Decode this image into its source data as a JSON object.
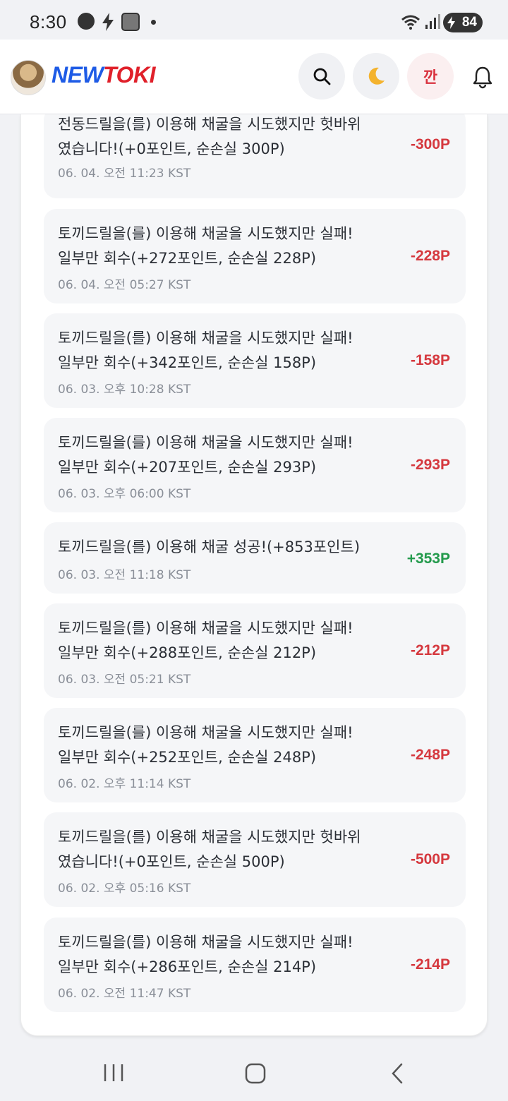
{
  "status": {
    "time": "8:30",
    "battery": "84"
  },
  "header": {
    "logo_part1": "NEW",
    "logo_part2": "TOKI",
    "kkan_label": "깐"
  },
  "points_history": [
    {
      "line1": "전동드릴을(를) 이용해 채굴을 시도했지만 헛바위",
      "line2": "였습니다!(+0포인트, 순손실 300P)",
      "time": "06. 04. 오전 11:23 KST",
      "amount": "-300P",
      "positive": false
    },
    {
      "line1": "토끼드릴을(를) 이용해 채굴을 시도했지만 실패!",
      "line2": "일부만 회수(+272포인트, 순손실 228P)",
      "time": "06. 04. 오전 05:27 KST",
      "amount": "-228P",
      "positive": false
    },
    {
      "line1": "토끼드릴을(를) 이용해 채굴을 시도했지만 실패!",
      "line2": "일부만 회수(+342포인트, 순손실 158P)",
      "time": "06. 03. 오후 10:28 KST",
      "amount": "-158P",
      "positive": false
    },
    {
      "line1": "토끼드릴을(를) 이용해 채굴을 시도했지만 실패!",
      "line2": "일부만 회수(+207포인트, 순손실 293P)",
      "time": "06. 03. 오후 06:00 KST",
      "amount": "-293P",
      "positive": false
    },
    {
      "line1": "토끼드릴을(를) 이용해 채굴 성공!(+853포인트)",
      "line2": "",
      "time": "06. 03. 오전 11:18 KST",
      "amount": "+353P",
      "positive": true
    },
    {
      "line1": "토끼드릴을(를) 이용해 채굴을 시도했지만 실패!",
      "line2": "일부만 회수(+288포인트, 순손실 212P)",
      "time": "06. 03. 오전 05:21 KST",
      "amount": "-212P",
      "positive": false
    },
    {
      "line1": "토끼드릴을(를) 이용해 채굴을 시도했지만 실패!",
      "line2": "일부만 회수(+252포인트, 순손실 248P)",
      "time": "06. 02. 오후 11:14 KST",
      "amount": "-248P",
      "positive": false
    },
    {
      "line1": "토끼드릴을(를) 이용해 채굴을 시도했지만 헛바위",
      "line2": "였습니다!(+0포인트, 순손실 500P)",
      "time": "06. 02. 오후 05:16 KST",
      "amount": "-500P",
      "positive": false
    },
    {
      "line1": "토끼드릴을(를) 이용해 채굴을 시도했지만 실패!",
      "line2": "일부만 회수(+286포인트, 순손실 214P)",
      "time": "06. 02. 오전 11:47 KST",
      "amount": "-214P",
      "positive": false
    }
  ],
  "colors": {
    "negative": "#d5383e",
    "positive": "#239a4c",
    "brand_blue": "#1e5be6",
    "brand_red": "#e0202a"
  },
  "icons": [
    "wear-icon",
    "bolt-icon",
    "app-icon",
    "wifi-icon",
    "signal-icon",
    "battery-icon",
    "search-icon",
    "moon-icon",
    "bell-icon",
    "recents-icon",
    "home-icon",
    "back-icon"
  ]
}
